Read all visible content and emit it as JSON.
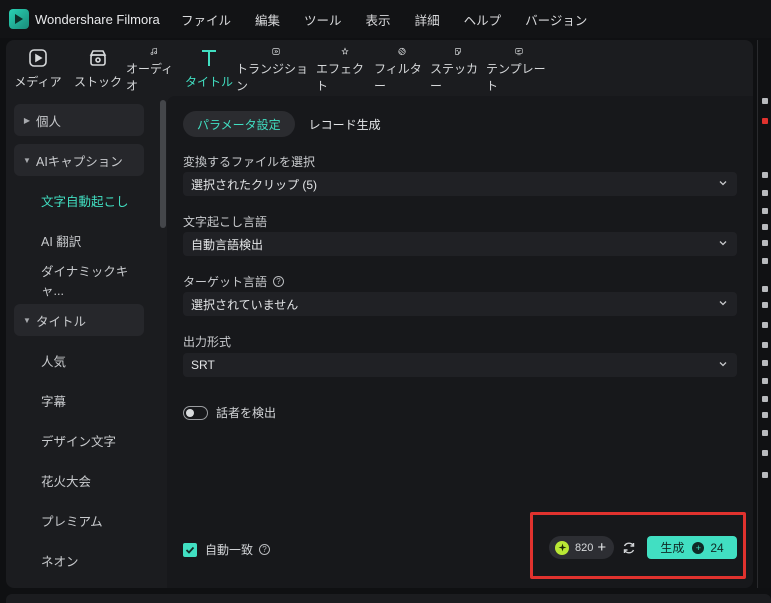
{
  "app": {
    "title": "Wondershare Filmora"
  },
  "menu": [
    "ファイル",
    "編集",
    "ツール",
    "表示",
    "詳細",
    "ヘルプ",
    "バージョン"
  ],
  "toolbar": [
    {
      "label": "メディア",
      "icon": "media-icon"
    },
    {
      "label": "ストック",
      "icon": "stock-icon"
    },
    {
      "label": "オーディオ",
      "icon": "audio-note-icon"
    },
    {
      "label": "タイトル",
      "icon": "title-t-icon",
      "active": true
    },
    {
      "label": "トランジション",
      "icon": "transition-icon"
    },
    {
      "label": "エフェクト",
      "icon": "effect-icon"
    },
    {
      "label": "フィルター",
      "icon": "filter-icon"
    },
    {
      "label": "ステッカー",
      "icon": "sticker-icon"
    },
    {
      "label": "テンプレート",
      "icon": "template-icon"
    }
  ],
  "sidebar": {
    "items": [
      {
        "label": "個人",
        "type": "group",
        "expanded": false
      },
      {
        "label": "AIキャプション",
        "type": "group",
        "expanded": true
      },
      {
        "label": "文字自動起こし",
        "type": "sub",
        "active": true
      },
      {
        "label": "AI 翻訳",
        "type": "sub"
      },
      {
        "label": "ダイナミックキャ...",
        "type": "sub"
      },
      {
        "label": "タイトル",
        "type": "group",
        "expanded": true
      },
      {
        "label": "人気",
        "type": "sub"
      },
      {
        "label": "字幕",
        "type": "sub"
      },
      {
        "label": "デザイン文字",
        "type": "sub"
      },
      {
        "label": "花火大会",
        "type": "sub"
      },
      {
        "label": "プレミアム",
        "type": "sub"
      },
      {
        "label": "ネオン",
        "type": "sub"
      }
    ]
  },
  "tabs": [
    {
      "label": "パラメータ設定",
      "active": true
    },
    {
      "label": "レコード生成",
      "active": false
    }
  ],
  "fields": {
    "file": {
      "label": "変換するファイルを選択",
      "value": "選択されたクリップ (5)"
    },
    "language": {
      "label": "文字起こし言語",
      "value": "自動言語検出"
    },
    "target": {
      "label": "ターゲット言語",
      "value": "選択されていません"
    },
    "format": {
      "label": "出力形式",
      "value": "SRT"
    }
  },
  "speaker_toggle": {
    "label": "話者を検出",
    "on": false
  },
  "auto_match": {
    "label": "自動一致",
    "checked": true
  },
  "credits": {
    "value": "820"
  },
  "generate": {
    "label": "生成",
    "cost": "24"
  },
  "colors": {
    "accent": "#41dfc2",
    "highlight": "#e0322e",
    "panel": "#1b1c1f"
  }
}
